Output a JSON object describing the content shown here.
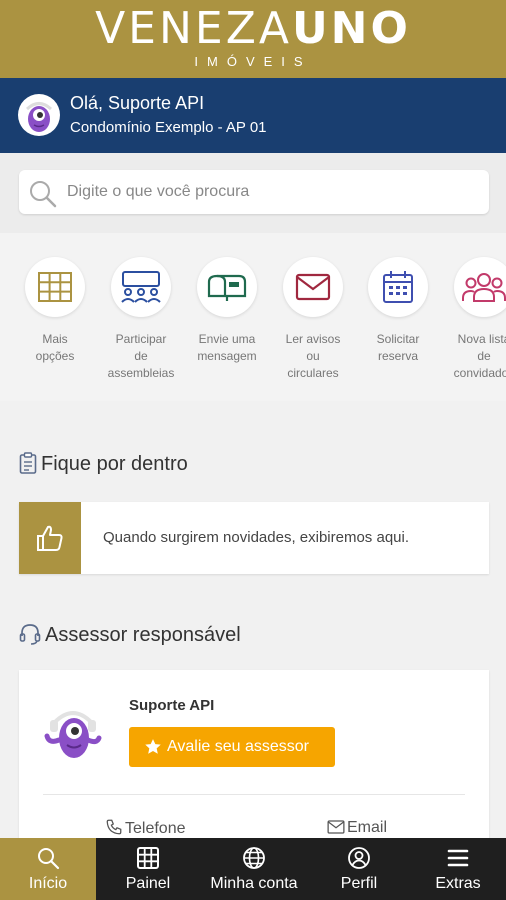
{
  "brand": {
    "logo_thin": "VENEZA",
    "logo_bold": "UNO",
    "logo_sub": "IMÓVEIS"
  },
  "user": {
    "greeting": "Olá, Suporte API",
    "condo": "Condomínio Exemplo - AP 01"
  },
  "search": {
    "placeholder": "Digite o que você procura"
  },
  "shortcuts": [
    {
      "label": "Mais\nopções",
      "icon": "grid-icon"
    },
    {
      "label": "Participar\nde\nassembleias",
      "icon": "assembly-icon"
    },
    {
      "label": "Envie uma\nmensagem",
      "icon": "mailbox-icon"
    },
    {
      "label": "Ler avisos\nou\ncirculares",
      "icon": "envelope-icon"
    },
    {
      "label": "Solicitar\nreserva",
      "icon": "calendar-icon"
    },
    {
      "label": "Nova lista\nde\nconvidados",
      "icon": "guests-icon"
    }
  ],
  "news": {
    "title": "Fique por dentro",
    "empty_text": "Quando surgirem novidades, exibiremos aqui."
  },
  "advisor": {
    "title": "Assessor responsável",
    "name": "Suporte API",
    "rate_label": "Avalie seu assessor",
    "phone_label": "Telefone",
    "email_label": "Email"
  },
  "tabs": [
    {
      "label": "Início",
      "icon": "search-icon",
      "active": true
    },
    {
      "label": "Painel",
      "icon": "grid-icon"
    },
    {
      "label": "Minha conta",
      "icon": "globe-icon"
    },
    {
      "label": "Perfil",
      "icon": "user-icon"
    },
    {
      "label": "Extras",
      "icon": "menu-icon"
    }
  ],
  "colors": {
    "gold": "#ab9341",
    "navy": "#193e70",
    "orange": "#f6a500",
    "tabbar": "#1f1f1f"
  }
}
